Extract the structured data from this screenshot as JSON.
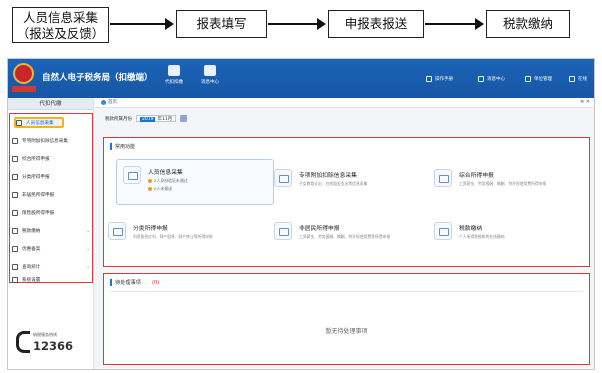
{
  "flow": {
    "steps": [
      "人员信息采集",
      "（报送及反馈）",
      "报表填写",
      "申报表报送",
      "税款缴纳"
    ]
  },
  "app": {
    "title": "自然人电子税务局（扣缴端）",
    "toolbar": [
      {
        "label": "代扣扣缴",
        "icon": "doc-icon"
      },
      {
        "label": "消息中心",
        "icon": "excel-icon"
      }
    ],
    "top_links": [
      {
        "label": "操作手册",
        "icon": "manual-icon"
      },
      {
        "label": "消息中心",
        "icon": "message-icon"
      },
      {
        "label": "单位管理",
        "icon": "org-icon"
      },
      {
        "label": "在线",
        "icon": "online-icon"
      }
    ],
    "accent": "#1657a6"
  },
  "sidebar": {
    "header": "代扣代缴",
    "items": [
      {
        "label": "人员信息采集",
        "icon": "user-icon",
        "active": true
      },
      {
        "label": "专项附加扣除信息采集",
        "icon": "form-icon"
      },
      {
        "label": "综合所得申报",
        "icon": "report-icon"
      },
      {
        "label": "分类所得申报",
        "icon": "pie-icon"
      },
      {
        "label": "非居民所得申报",
        "icon": "person-icon"
      },
      {
        "label": "限售股所得申报",
        "icon": "stock-icon"
      },
      {
        "label": "税款缴纳",
        "icon": "tax-icon",
        "chevron": "⌄"
      },
      {
        "label": "优惠备案",
        "icon": "gift-icon",
        "chevron": "⌄"
      },
      {
        "label": "查询统计",
        "icon": "search-icon",
        "chevron": "⌄"
      },
      {
        "label": "系统设置",
        "icon": "gear-icon"
      }
    ],
    "hotline_caption": "纳税服务热线",
    "hotline": "12366"
  },
  "main": {
    "tab_home": "首页",
    "tab_controls": "≡ ×",
    "period_label": "税款所属月份",
    "period_year": "2019",
    "period_month": "年11月",
    "common_title": "常用功能",
    "cards": [
      {
        "title": "人员信息采集",
        "lines": [
          "2人身份验证未通过",
          "0人未报送"
        ],
        "featured": true
      },
      {
        "title": "专项附加扣除信息采集",
        "desc": "子女教育支出、住房租金支出等信息采集"
      },
      {
        "title": "综合所得申报",
        "desc": "工资薪金、劳务报酬、稿酬、特许权使用费所得申报"
      },
      {
        "title": "分类所得申报",
        "desc": "利息股息红利、财产租赁、财产转让等所得申报"
      },
      {
        "title": "非居民所得申报",
        "desc": "工资薪金、劳务报酬、稿酬、特许权使用费等所得申报"
      },
      {
        "title": "税款缴纳",
        "desc": "个人所得税税款的在线缴纳"
      }
    ],
    "todo_title": "待处理事项",
    "todo_count": "(0)",
    "todo_empty": "暂无待处理事项"
  }
}
